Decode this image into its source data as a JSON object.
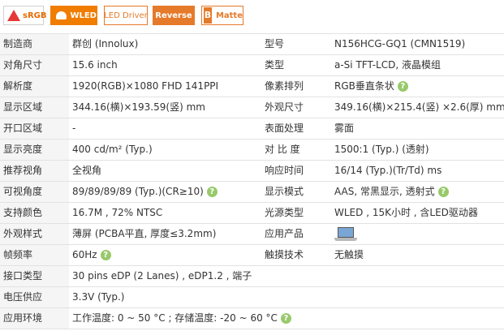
{
  "badges": [
    {
      "label": "sRGB",
      "icon": "srgb-triangle-icon"
    },
    {
      "label": "WLED",
      "icon": "wled-icon"
    },
    {
      "label": "LED Driver"
    },
    {
      "label": "Reverse"
    },
    {
      "label": "Matte",
      "icon_text": "B"
    }
  ],
  "help_glyph": "?",
  "rows": [
    {
      "k1": "制造商",
      "v1": "群创 (Innolux)",
      "k2": "型号",
      "v2": "N156HCG-GQ1 (CMN1519)"
    },
    {
      "k1": "对角尺寸",
      "v1": "15.6 inch",
      "k2": "类型",
      "v2": "a-Si TFT-LCD, 液晶模组"
    },
    {
      "k1": "解析度",
      "v1": "1920(RGB)×1080   FHD   141PPI",
      "k2": "像素排列",
      "v2": "RGB垂直条状"
    },
    {
      "k1": "显示区域",
      "v1": "344.16(横)×193.59(竖) mm",
      "k2": "外观尺寸",
      "v2": "349.16(横)×215.4(竖) ×2.6(厚) mm"
    },
    {
      "k1": "开口区域",
      "v1": "-",
      "k2": "表面处理",
      "v2": "雾面"
    },
    {
      "k1": "显示亮度",
      "v1": "400 cd/m² (Typ.)",
      "k2": "对 比 度",
      "v2": "1500:1 (Typ.) (透射)"
    },
    {
      "k1": "推荐视角",
      "v1": "全视角",
      "k2": "响应时间",
      "v2": "16/14 (Typ.)(Tr/Td) ms"
    },
    {
      "k1": "可视角度",
      "v1": "89/89/89/89 (Typ.)(CR≥10)",
      "k2": "显示模式",
      "v2": "AAS, 常黑显示, 透射式"
    },
    {
      "k1": "支持颜色",
      "v1": "16.7M , 72% NTSC",
      "k2": "光源类型",
      "v2": "WLED , 15K小时 , 含LED驱动器"
    },
    {
      "k1": "外观样式",
      "v1": "薄屏 (PCBA平直, 厚度≤3.2mm)",
      "k2": "应用产品",
      "v2": ""
    },
    {
      "k1": "帧频率",
      "v1": "60Hz",
      "k2": "触摸技术",
      "v2": "无触摸"
    },
    {
      "k1": "接口类型",
      "v1": "30 pins   eDP (2 Lanes) , eDP1.2 , 端子"
    },
    {
      "k1": "电压供应",
      "v1": "3.3V (Typ.)"
    },
    {
      "k1": "应用环境",
      "v1": "工作温度: 0 ~ 50 °C ; 存储温度: -20 ~ 60 °C"
    }
  ]
}
